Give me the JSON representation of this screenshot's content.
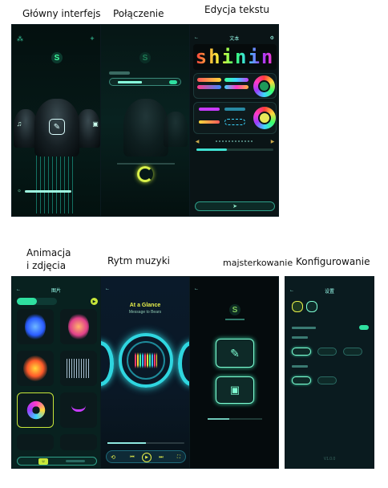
{
  "captions": {
    "main": "Główny interfejs",
    "connection": "Połączenie",
    "text_edit": "Edycja tekstu",
    "animation_line1": "Animacja",
    "animation_line2": "i zdjęcia",
    "music": "Rytm muzyki",
    "diy": "majsterkowanie",
    "config": "Konfigurowanie"
  },
  "text_edit_screen": {
    "title": "文本",
    "preview_text": "shinin"
  },
  "animation_screen": {
    "title": "图片"
  },
  "music_screen": {
    "headline": "At a Glance",
    "subline": "Message to Bears"
  },
  "config_screen": {
    "title": "设置",
    "version": "V1.0.0"
  },
  "colors": {
    "accent": "#2fe0a0",
    "accent_bright": "#7fffd4",
    "background": "#050d10"
  }
}
